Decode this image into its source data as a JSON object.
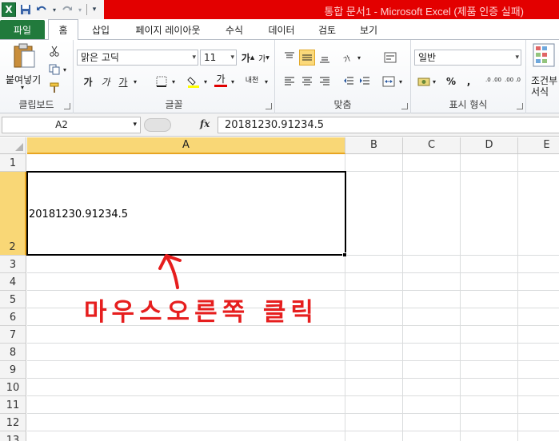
{
  "window": {
    "title": "통합 문서1 - Microsoft Excel (제품 인증 실패)",
    "app_icon": "X"
  },
  "ribbon_tabs": [
    "파일",
    "홈",
    "삽입",
    "페이지 레이아웃",
    "수식",
    "데이터",
    "검토",
    "보기"
  ],
  "ribbon": {
    "clipboard": {
      "paste_label": "붙여넣기",
      "group_label": "클립보드"
    },
    "font": {
      "font_name": "맑은 고딕",
      "font_size": "11",
      "group_label": "글꼴",
      "bold": "가",
      "italic": "가",
      "underline": "가",
      "grow": "가",
      "shrink": "가",
      "color": "가",
      "phonetic": "내천"
    },
    "alignment": {
      "group_label": "맞춤"
    },
    "number": {
      "format": "일반",
      "group_label": "표시 형식",
      "percent": "%",
      "comma": ",",
      "inc_decimal": ".0 .00",
      "dec_decimal": ".00 .0"
    },
    "styles": {
      "conditional_line1": "조건부",
      "conditional_line2": "서식"
    }
  },
  "formula_bar": {
    "name_box": "A2",
    "fx_label": "fx",
    "content": "20181230.91234.5"
  },
  "columns": [
    "A",
    "B",
    "C",
    "D",
    "E"
  ],
  "rows": [
    "1",
    "2",
    "3",
    "4",
    "5",
    "6",
    "7",
    "8",
    "9",
    "10",
    "11",
    "12",
    "13"
  ],
  "cells": {
    "A2": "20181230.91234.5"
  },
  "annotation": {
    "text": "마우스오른쪽 클릭",
    "color": "#e61e1e"
  },
  "colors": {
    "title_bar": "#e30000",
    "file_tab": "#217a3c",
    "selection_header": "#f9d776"
  }
}
